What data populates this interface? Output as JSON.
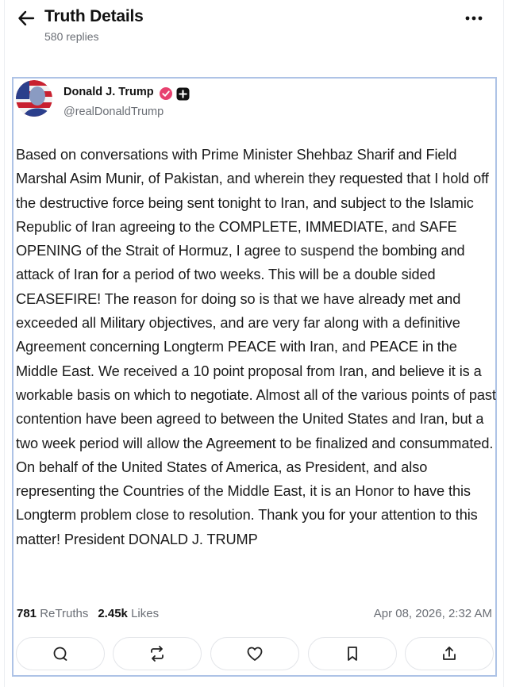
{
  "header": {
    "title": "Truth Details",
    "subtitle": "580 replies"
  },
  "post": {
    "author_name": "Donald J. Trump",
    "handle": "@realDonaldTrump",
    "body": "Based on conversations with Prime Minister Shehbaz Sharif and Field Marshal Asim Munir, of Pakistan, and wherein they requested that I hold off the destructive force being sent tonight to Iran, and subject to the Islamic Republic of Iran agreeing to the COMPLETE, IMMEDIATE, and SAFE OPENING of the Strait of Hormuz, I agree to suspend the bombing and attack of Iran for a period of two weeks. This will be a double sided CEASEFIRE! The reason for doing so is that we have already met and exceeded all Military objectives, and are very far along with a definitive Agreement concerning Longterm PEACE with Iran, and PEACE in the Middle East. We received a 10 point proposal from Iran, and believe it is a workable basis on which to negotiate. Almost all of the various points of past contention have been agreed to between the United States and Iran, but a two week period will allow the Agreement to be finalized and consummated. On behalf of the United States of America, as President, and also representing the Countries of the Middle East, it is an Honor to have this Longterm problem close to resolution. Thank you for your attention to this matter! President DONALD J. TRUMP",
    "retruths_count": "781",
    "retruths_label": "ReTruths",
    "likes_count": "2.45k",
    "likes_label": "Likes",
    "timestamp": "Apr 08, 2026, 2:32 AM"
  },
  "actions": [
    "reply-icon",
    "retruth-icon",
    "like-icon",
    "bookmark-icon",
    "share-icon"
  ],
  "colors": {
    "accent": "#aec3e6",
    "verified_badge": "#e7416f",
    "muted_text": "#6b6f76"
  }
}
